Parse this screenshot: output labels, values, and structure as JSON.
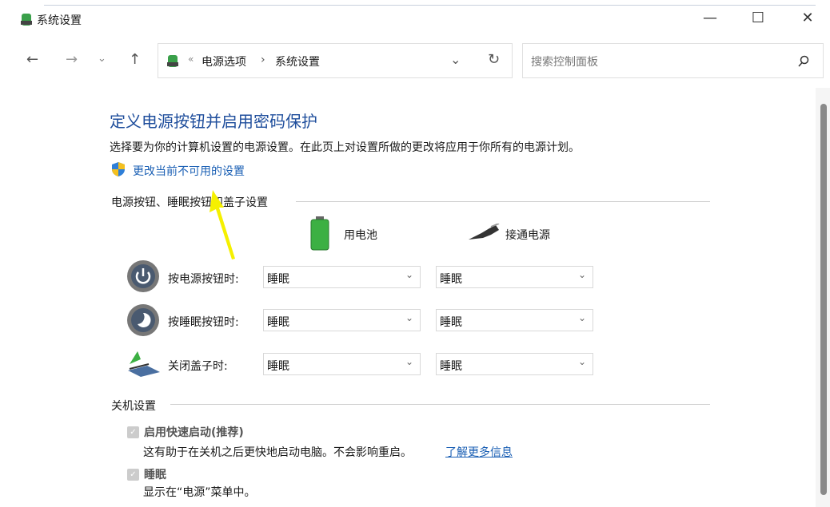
{
  "window": {
    "title": "系统设置",
    "minimize": "—",
    "maximize": "☐",
    "close": "✕"
  },
  "nav": {
    "back": "←",
    "forward": "→",
    "recent": "⌄",
    "up": "↑",
    "refresh": "↻",
    "dropdown": "⌄"
  },
  "address": {
    "sep": "«",
    "crumbs": [
      "电源选项",
      "系统设置"
    ],
    "arrow": "›"
  },
  "search": {
    "placeholder": "搜索控制面板",
    "icon": "search-icon"
  },
  "page": {
    "heading": "定义电源按钮并启用密码保护",
    "description": "选择要为你的计算机设置的电源设置。在此页上对设置所做的更改将应用于你所有的电源计划。",
    "change_link": "更改当前不可用的设置",
    "section1": "电源按钮、睡眠按钮和盖子设置",
    "col_battery": "用电池",
    "col_plugged": "接通电源",
    "rows": [
      {
        "label": "按电源按钮时:",
        "battery": "睡眠",
        "plugged": "睡眠",
        "icon": "power-button-icon"
      },
      {
        "label": "按睡眠按钮时:",
        "battery": "睡眠",
        "plugged": "睡眠",
        "icon": "sleep-button-icon"
      },
      {
        "label": "关闭盖子时:",
        "battery": "睡眠",
        "plugged": "睡眠",
        "icon": "laptop-lid-icon"
      }
    ],
    "section2": "关机设置",
    "fast_startup": {
      "label": "启用快速启动(推荐)",
      "checked": true,
      "desc": "这有助于在关机之后更快地启动电脑。不会影响重启。",
      "link": "了解更多信息"
    },
    "sleep": {
      "label": "睡眠",
      "checked": true,
      "desc": "显示在“电源”菜单中。"
    }
  },
  "colors": {
    "heading": "#1f4e9c",
    "link": "#1a5fb4",
    "annotation_arrow": "#f5f000"
  }
}
